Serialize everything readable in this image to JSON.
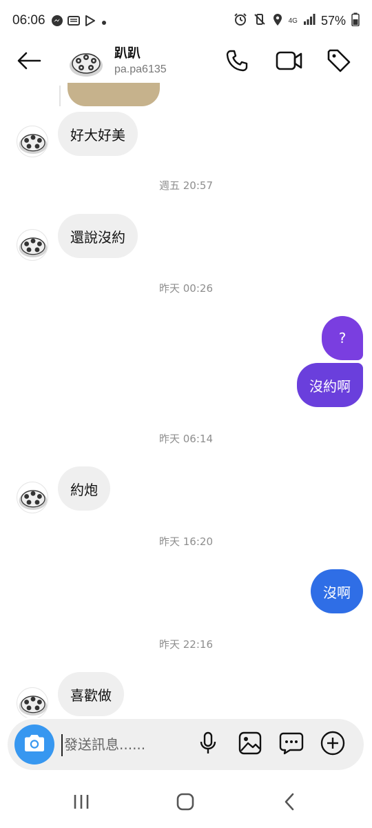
{
  "status_bar": {
    "time": "06:06",
    "battery": "57%",
    "network": "4G",
    "left_icons": [
      "messenger-icon",
      "notes-icon",
      "play-store-icon",
      "dot-icon"
    ],
    "right_icons": [
      "alarm-icon",
      "vibrate-mute-icon",
      "location-icon",
      "signal-icon",
      "battery-icon"
    ]
  },
  "header": {
    "name": "趴趴",
    "username": "pa.pa6135",
    "icons": [
      "back-arrow-icon",
      "phone-icon",
      "video-icon",
      "tag-icon"
    ]
  },
  "messages": [
    {
      "type": "media",
      "direction": "in"
    },
    {
      "type": "text",
      "direction": "in",
      "text": "好大好美"
    },
    {
      "type": "timestamp",
      "text": "週五 20:57"
    },
    {
      "type": "text",
      "direction": "in",
      "text": "還說沒約"
    },
    {
      "type": "timestamp",
      "text": "昨天 00:26"
    },
    {
      "type": "text",
      "direction": "out",
      "text": "?",
      "color": "#7a3ee0"
    },
    {
      "type": "text",
      "direction": "out",
      "text": "沒約啊",
      "color": "#6a3fdc"
    },
    {
      "type": "timestamp",
      "text": "昨天 06:14"
    },
    {
      "type": "text",
      "direction": "in",
      "text": "約炮"
    },
    {
      "type": "timestamp",
      "text": "昨天 16:20"
    },
    {
      "type": "text",
      "direction": "out",
      "text": "沒啊",
      "color": "#2f6ee6"
    },
    {
      "type": "timestamp",
      "text": "昨天 22:16"
    },
    {
      "type": "text",
      "direction": "in",
      "text": "喜歡做"
    }
  ],
  "composer": {
    "placeholder": "發送訊息......",
    "icons": [
      "camera-icon",
      "microphone-icon",
      "gallery-icon",
      "sticker-chat-icon",
      "plus-icon"
    ]
  },
  "nav_bar": {
    "icons": [
      "recent-apps-icon",
      "home-icon",
      "back-icon"
    ]
  },
  "colors": {
    "incoming_bubble": "#efefef",
    "camera_button": "#3797f0",
    "timestamp": "#8e8e8e"
  }
}
